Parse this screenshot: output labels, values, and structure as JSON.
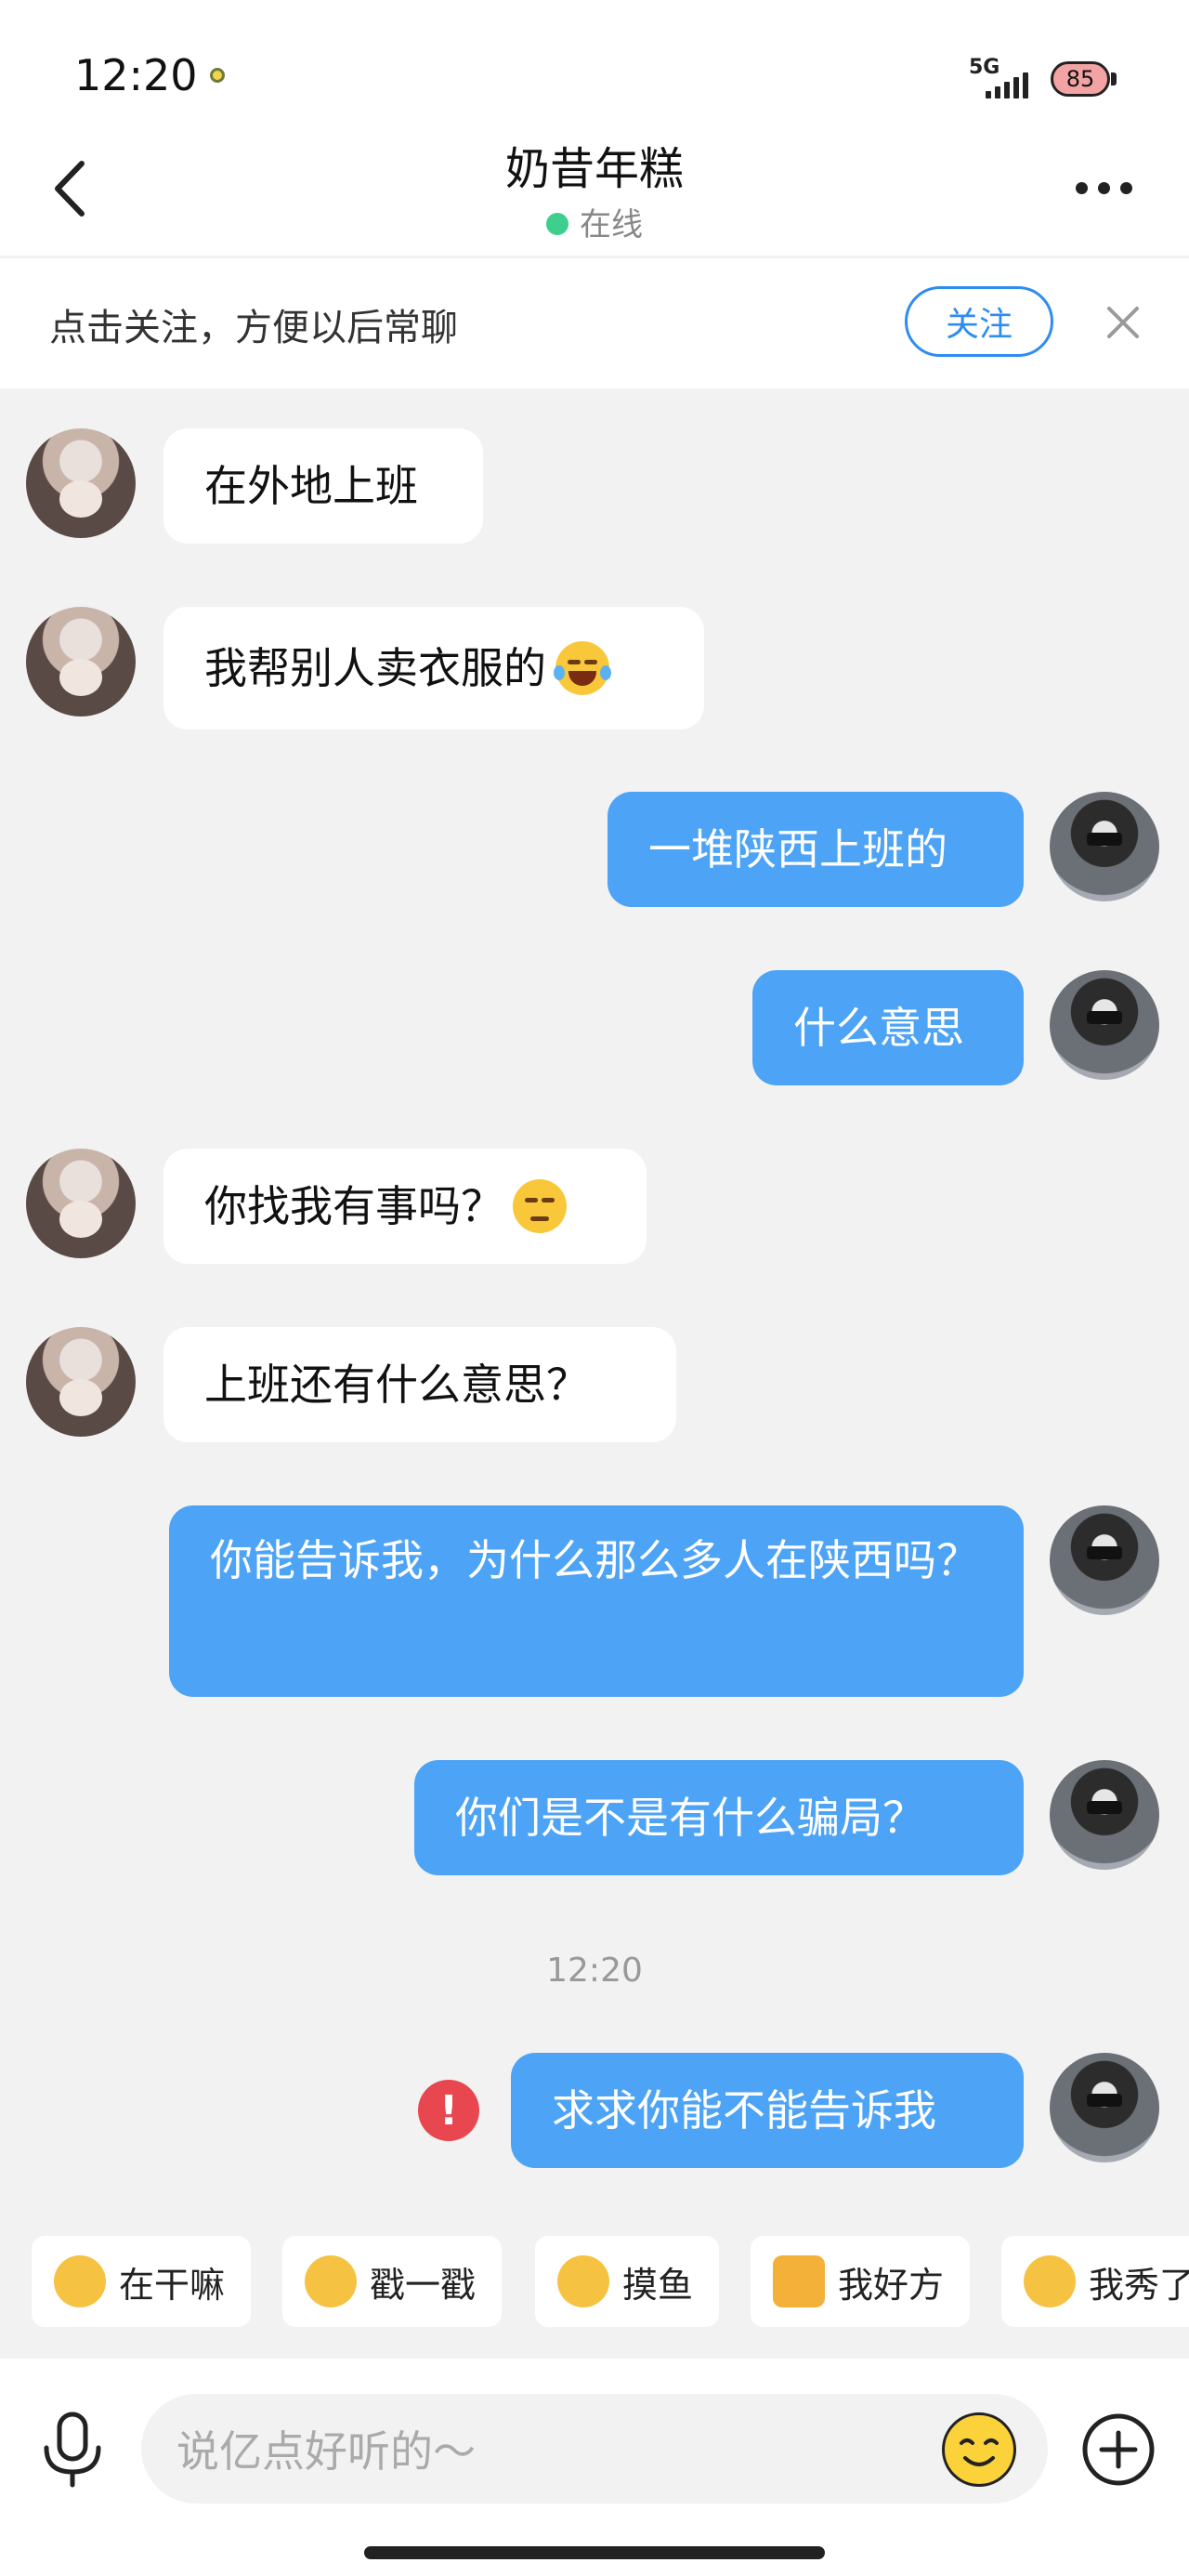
{
  "status_bar": {
    "time": "12:20",
    "network": "5G",
    "battery": "85"
  },
  "header": {
    "title": "奶昔年糕",
    "status": "在线"
  },
  "follow_bar": {
    "prompt": "点击关注，方便以后常聊",
    "button": "关注"
  },
  "messages": [
    {
      "side": "in",
      "text": "在外地上班"
    },
    {
      "side": "in",
      "text": "我帮别人卖衣服的",
      "emoji": "laugh-cry"
    },
    {
      "side": "out",
      "text": "一堆陕西上班的"
    },
    {
      "side": "out",
      "text": "什么意思"
    },
    {
      "side": "in",
      "text": "你找我有事吗？",
      "emoji": "unamused"
    },
    {
      "side": "in",
      "text": "上班还有什么意思？"
    },
    {
      "side": "out",
      "text": "你能告诉我，为什么那么多人在陕西吗？"
    },
    {
      "side": "out",
      "text": "你们是不是有什么骗局？"
    },
    {
      "side": "out",
      "text": "求求你能不能告诉我",
      "failed": true
    }
  ],
  "timestamp": "12:20",
  "quick_actions": [
    "在干嘛",
    "戳一戳",
    "摸鱼",
    "我好方",
    "我秀了"
  ],
  "input": {
    "placeholder": "说亿点好听的～"
  },
  "colors": {
    "outgoing_bubble": "#4da3f5",
    "incoming_bubble": "#ffffff",
    "accent": "#2f8cf0",
    "error": "#e8474f",
    "online": "#3ecf8e"
  }
}
